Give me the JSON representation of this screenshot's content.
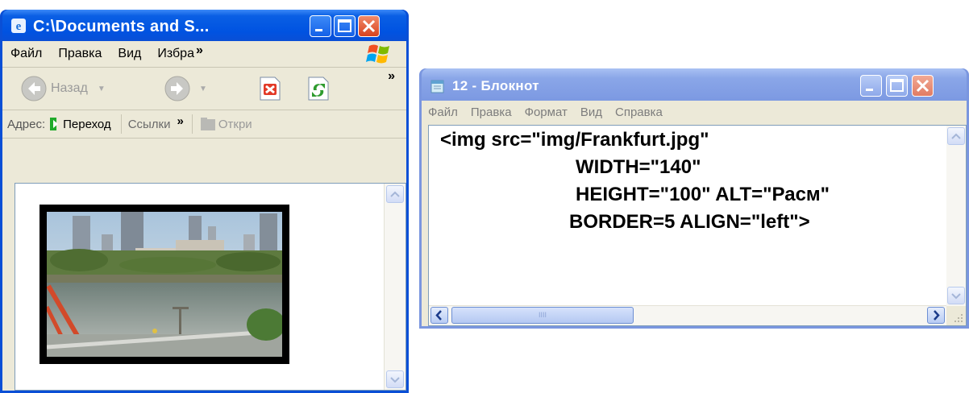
{
  "ie_window": {
    "title": "C:\\Documents and S...",
    "menu": [
      "Файл",
      "Правка",
      "Вид",
      "Избра"
    ],
    "menu_overflow": "»",
    "toolbar": {
      "back_label": "Назад",
      "overflow": "»"
    },
    "address_bar": {
      "address_label": "Адрес:",
      "go_label": "Переход",
      "links_label": "Ссылки",
      "links_overflow": "»",
      "open_label": "Откри"
    },
    "colors": {
      "titlebar": "#0a4fd6",
      "close": "#d9431e"
    }
  },
  "notepad_window": {
    "title": "12 - Блокнот",
    "menu": [
      "Файл",
      "Правка",
      "Формат",
      "Вид",
      "Справка"
    ],
    "code_lines": [
      "<img src=\"img/Frankfurt.jpg\"",
      "WIDTH=\"140\"",
      "HEIGHT=\"100\" ALT=\"Расм\"",
      "BORDER=5 ALIGN=\"left\">"
    ],
    "hscroll_grip": "IIII",
    "colors": {
      "titlebar": "#7a96df"
    }
  },
  "icons": [
    "ie-icon",
    "notepad-icon",
    "minimize-icon",
    "maximize-icon",
    "close-icon",
    "back-icon",
    "forward-icon",
    "stop-icon",
    "refresh-icon",
    "windows-logo-icon",
    "go-arrow-icon",
    "folder-icon"
  ]
}
